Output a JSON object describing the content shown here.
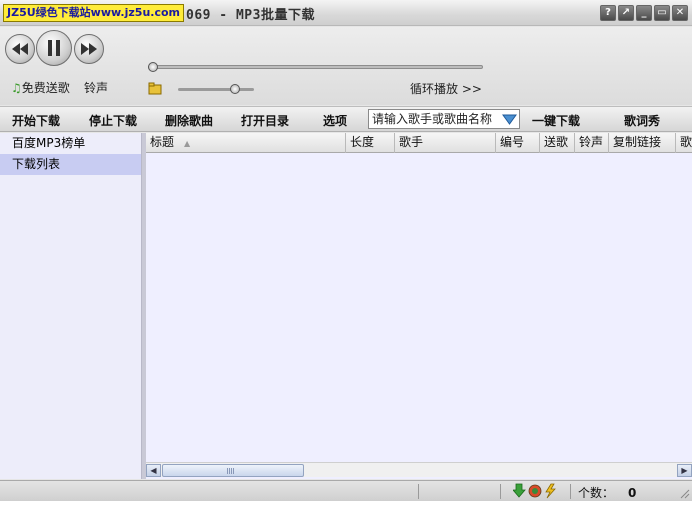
{
  "title": {
    "watermark": "JZ5U绿色下载站www.jz5u.com",
    "text": "069 - MP3批量下载",
    "buttons": [
      "?",
      "↗",
      "_",
      "▭",
      "✕"
    ]
  },
  "player": {
    "free_song": "免费送歌",
    "ringtone": "铃声",
    "loop_mode": "循环播放 >>"
  },
  "toolbar": {
    "start": "开始下载",
    "stop": "停止下载",
    "delete": "删除歌曲",
    "open_dir": "打开目录",
    "options": "选项",
    "search_placeholder": "请输入歌手或歌曲名称",
    "one_click": "一键下载",
    "lyrics": "歌词秀"
  },
  "sidebar": {
    "items": [
      {
        "label": "百度MP3榜单"
      },
      {
        "label": "下载列表"
      }
    ]
  },
  "table": {
    "columns": [
      "标题",
      "长度",
      "歌手",
      "编号",
      "送歌",
      "铃声",
      "复制链接",
      "歌"
    ],
    "rows": []
  },
  "status": {
    "count_label": "个数：",
    "count_value": "0"
  },
  "colors": {
    "selection": "#c8ccf2",
    "list_bg": "#efefff",
    "watermark_bg": "#ffec3a"
  }
}
